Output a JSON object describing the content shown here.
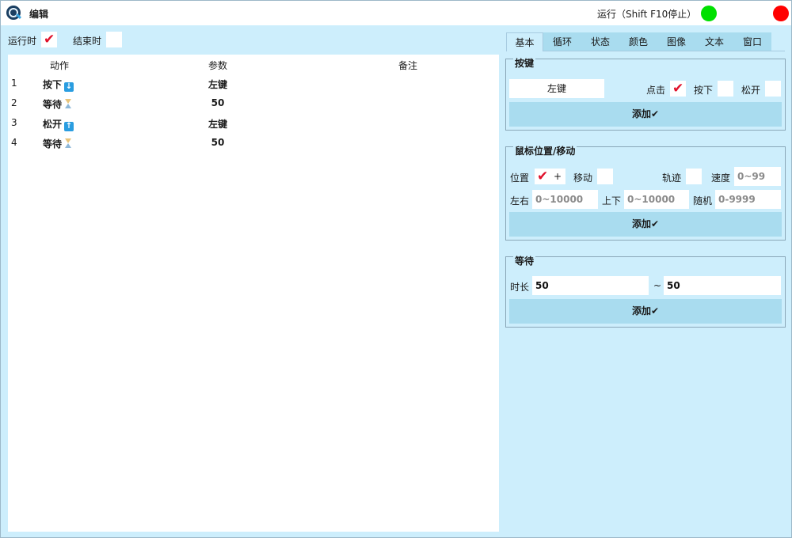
{
  "titlebar": {
    "title": "编辑",
    "run_status": "运行（Shift F10停止）"
  },
  "topbar": {
    "run_when_label": "运行时",
    "run_when_checked": true,
    "end_when_label": "结束时",
    "end_when_checked": false
  },
  "list": {
    "headers": {
      "action": "动作",
      "param": "参数",
      "note": "备注"
    },
    "rows": [
      {
        "idx": "1",
        "action": "按下",
        "icon": "arrow-down-icon",
        "param": "左键",
        "note": ""
      },
      {
        "idx": "2",
        "action": "等待",
        "icon": "hourglass-icon",
        "param": "50",
        "note": ""
      },
      {
        "idx": "3",
        "action": "松开",
        "icon": "arrow-up-icon",
        "param": "左键",
        "note": ""
      },
      {
        "idx": "4",
        "action": "等待",
        "icon": "hourglass-icon",
        "param": "50",
        "note": ""
      }
    ]
  },
  "tabs": [
    "基本",
    "循环",
    "状态",
    "颜色",
    "图像",
    "文本",
    "窗口"
  ],
  "key_group": {
    "title": "按键",
    "key_value": "左键",
    "click_label": "点击",
    "click_checked": true,
    "press_label": "按下",
    "press_checked": false,
    "release_label": "松开",
    "release_checked": false,
    "add_label": "添加✔"
  },
  "mouse_group": {
    "title": "鼠标位置/移动",
    "position_label": "位置",
    "position_checked": true,
    "plus_label": "+",
    "move_label": "移动",
    "move_checked": false,
    "track_label": "轨迹",
    "track_checked": false,
    "speed_label": "速度",
    "speed_placeholder": "0~99",
    "lr_label": "左右",
    "lr_placeholder": "0~10000",
    "ud_label": "上下",
    "ud_placeholder": "0~10000",
    "random_label": "随机",
    "random_placeholder": "0-9999",
    "add_label": "添加✔"
  },
  "wait_group": {
    "title": "等待",
    "duration_label": "时长",
    "min_value": "50",
    "tilde": "~",
    "max_value": "50",
    "add_label": "添加✔"
  },
  "colors": {
    "accent": "#cdeefc",
    "button": "#a9dcef",
    "check": "#e0102a",
    "run": "#00e000",
    "stop": "#ff0000"
  }
}
